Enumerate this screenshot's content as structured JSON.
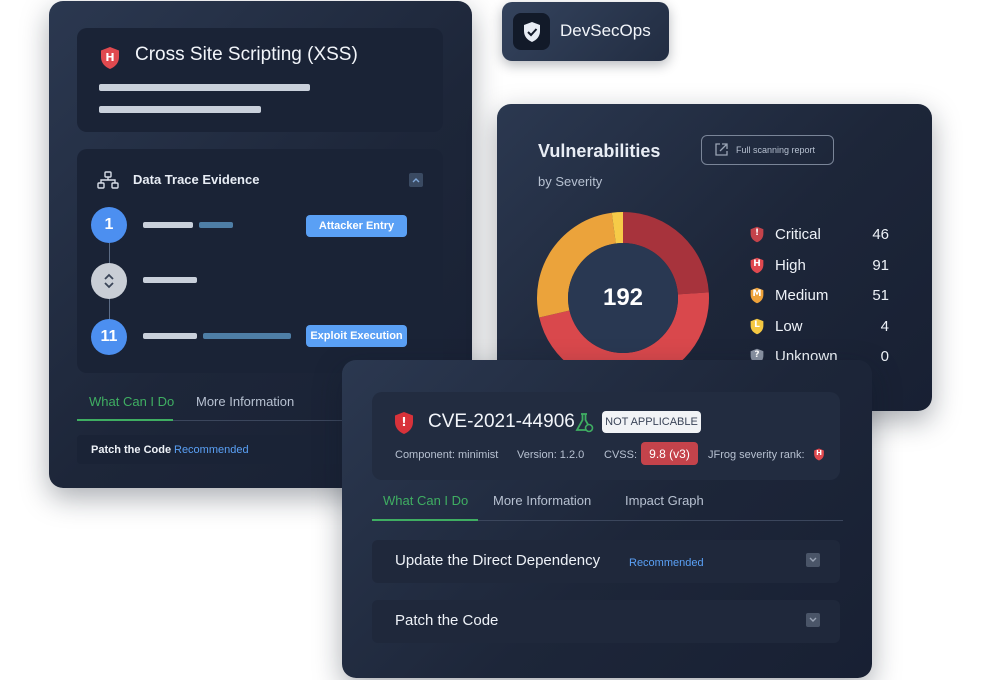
{
  "xss_card": {
    "title": "Cross Site Scripting (XSS)",
    "severity_letter": "H",
    "trace": {
      "title": "Data Trace Evidence",
      "steps": [
        {
          "number": "1",
          "pill": "Attacker Entry"
        },
        {
          "number": "11",
          "pill": "Exploit Execution"
        }
      ]
    },
    "tabs": [
      "What Can I Do",
      "More Information"
    ],
    "action": {
      "label": "Patch the Code",
      "tag": "Recommended"
    }
  },
  "badge": {
    "label": "DevSecOps",
    "icon": "shield-check-icon"
  },
  "vuln_card": {
    "title": "Vulnerabilities",
    "subtitle": "by Severity",
    "report_button": "Full scanning report",
    "total": "192",
    "legend": [
      {
        "name": "Critical",
        "value": "46",
        "letter": "!",
        "color": "#c4434b",
        "icon": "critical-shield-icon"
      },
      {
        "name": "High",
        "value": "91",
        "letter": "H",
        "color": "#e0494f",
        "icon": "high-shield-icon"
      },
      {
        "name": "Medium",
        "value": "51",
        "letter": "M",
        "color": "#eea23a",
        "icon": "medium-shield-icon"
      },
      {
        "name": "Low",
        "value": "4",
        "letter": "L",
        "color": "#f5c842",
        "icon": "low-shield-icon"
      },
      {
        "name": "Unknown",
        "value": "0",
        "letter": "?",
        "color": "#8a93a3",
        "icon": "unknown-shield-icon"
      }
    ]
  },
  "chart_data": {
    "type": "pie",
    "categories": [
      "Critical",
      "High",
      "Medium",
      "Low",
      "Unknown"
    ],
    "values": [
      46,
      91,
      51,
      4,
      0
    ],
    "colors": [
      "#a7333c",
      "#d9484c",
      "#eba33b",
      "#f6cb48",
      "#8a93a3"
    ],
    "center_label": "192"
  },
  "cve_card": {
    "id": "CVE-2021-44906",
    "applicability": "NOT APPLICABLE",
    "component": "Component: minimist",
    "version": "Version: 1.2.0",
    "cvss_label": "CVSS:",
    "cvss_value": "9.8 (v3)",
    "rank_label": "JFrog severity rank:",
    "rank_letter": "H",
    "tabs": [
      "What Can I Do",
      "More Information",
      "Impact Graph"
    ],
    "actions": [
      {
        "label": "Update the Direct Dependency",
        "tag": "Recommended"
      },
      {
        "label": "Patch the Code",
        "tag": ""
      }
    ]
  },
  "colors": {
    "accent_green": "#3fae62",
    "accent_blue": "#5aa0f5",
    "card_bg": "#1d2639"
  }
}
